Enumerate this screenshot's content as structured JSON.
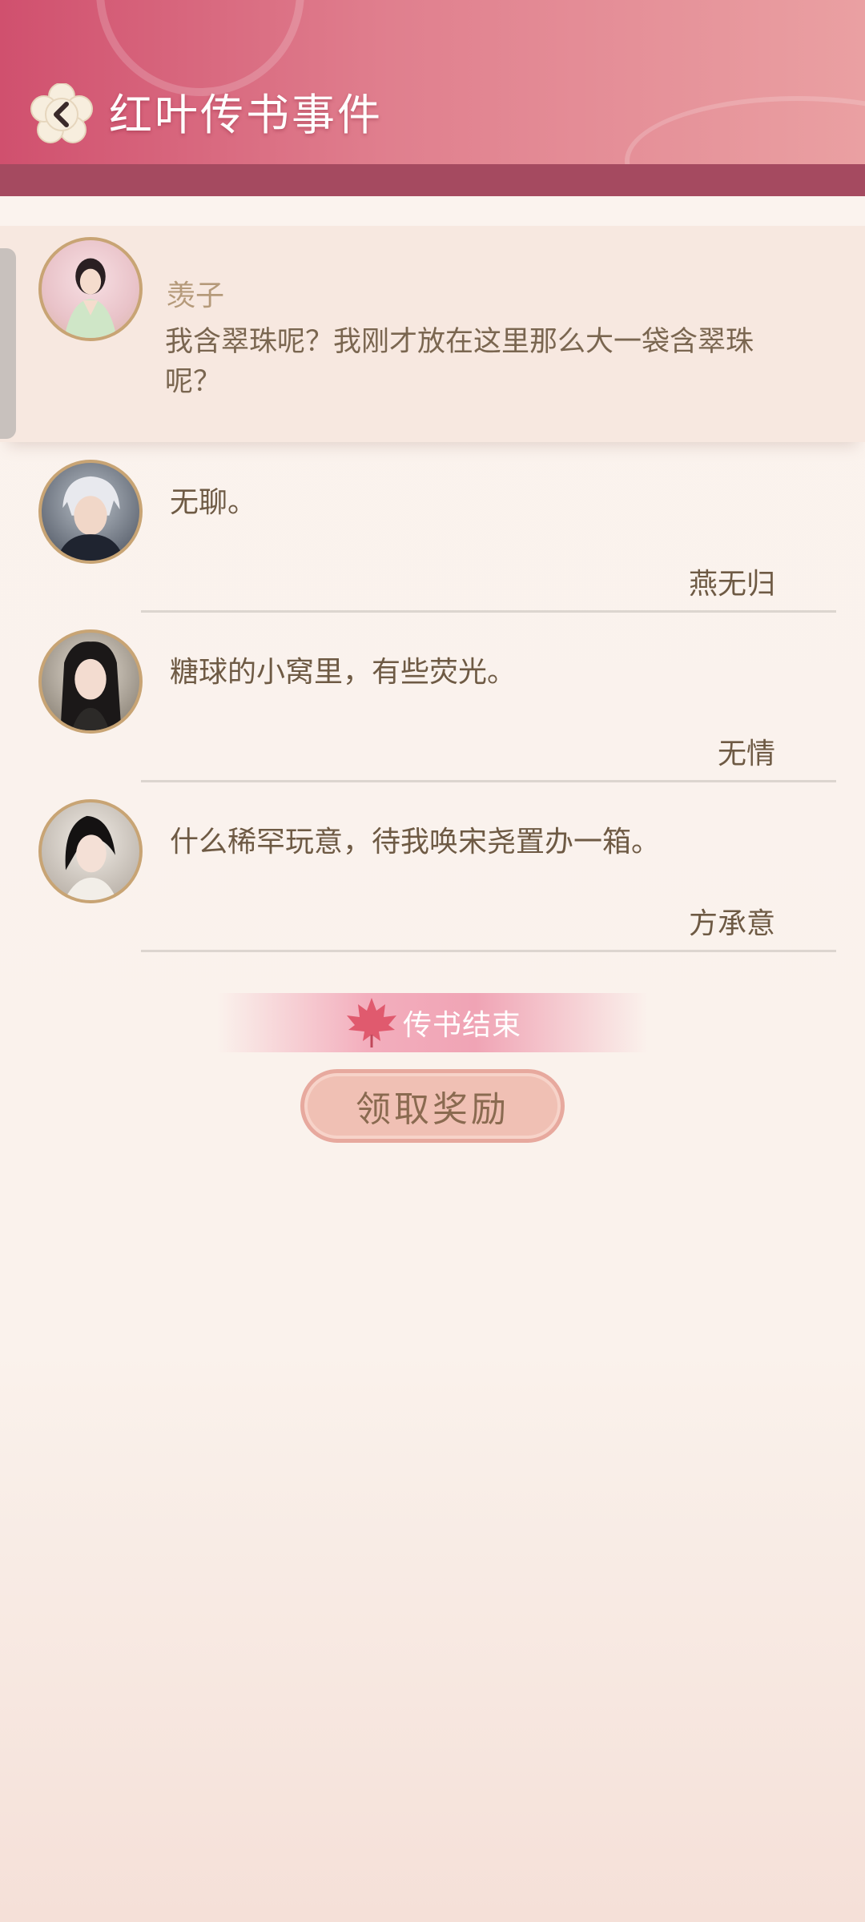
{
  "header": {
    "title": "红叶传书事件",
    "back_icon": "back-flower-icon"
  },
  "pinned": {
    "name": "羡子",
    "message": "我含翠珠呢？我刚才放在这里那么大一袋含翠珠呢？"
  },
  "messages": [
    {
      "text": "无聊。",
      "sender": "燕无归"
    },
    {
      "text": "糖球的小窝里，有些荧光。",
      "sender": "无情"
    },
    {
      "text": "什么稀罕玩意，待我唤宋尧置办一箱。",
      "sender": "方承意"
    }
  ],
  "end_banner": {
    "label": "传书结束",
    "icon": "maple-leaf-icon"
  },
  "claim_button": {
    "label": "领取奖励"
  },
  "colors": {
    "header_pink": "#d0506e",
    "header_band": "#a54a60",
    "text_brown": "#6e5a44",
    "button_fill": "#f0c0b4"
  }
}
